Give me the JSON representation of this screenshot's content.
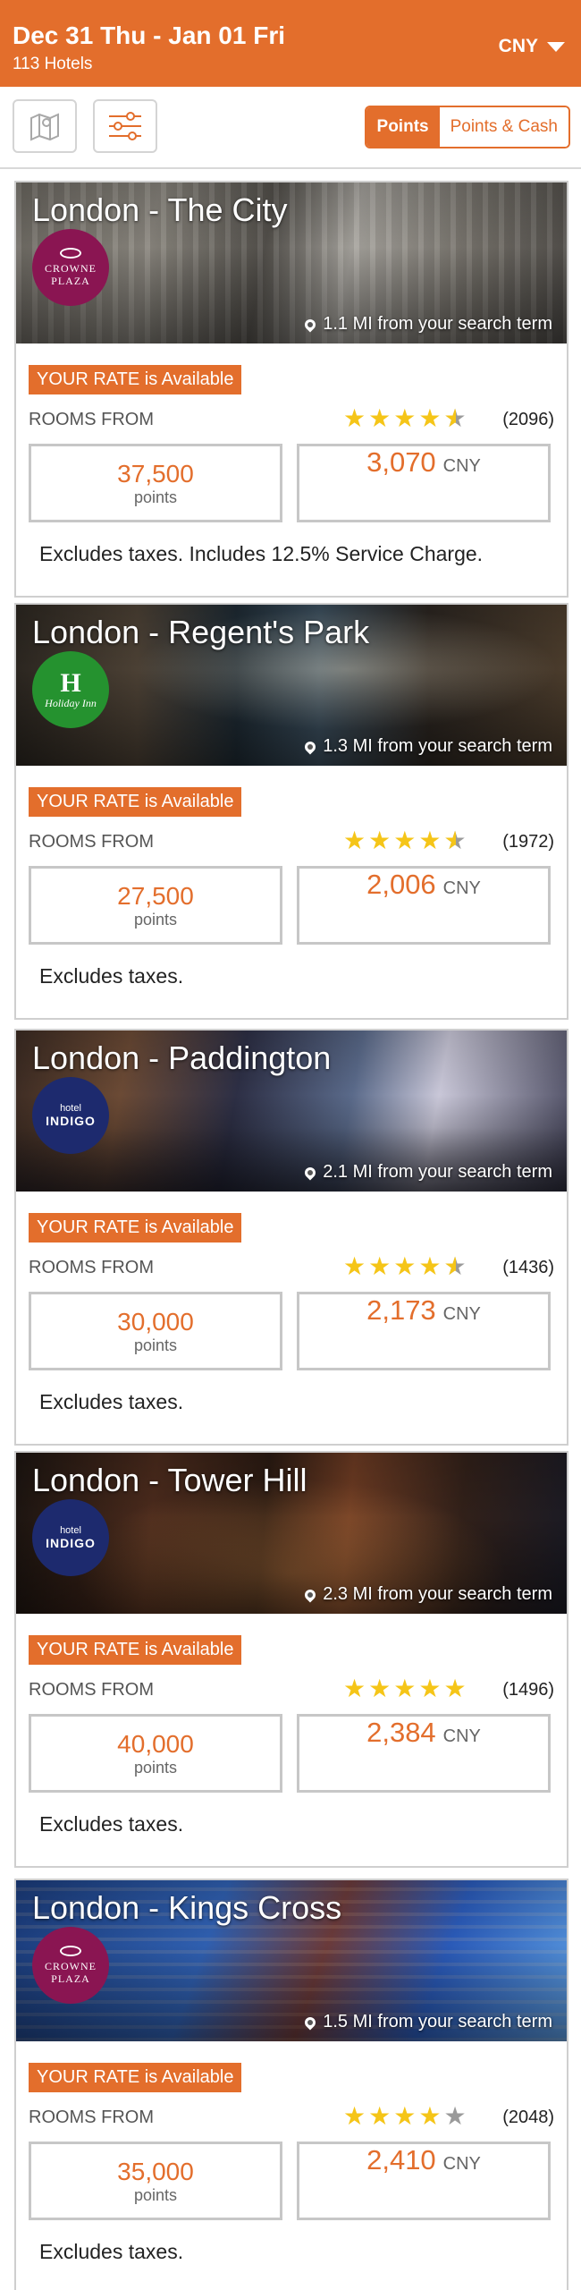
{
  "header": {
    "dates": "Dec 31 Thu - Jan 01 Fri",
    "hotel_count": "113 Hotels",
    "currency": "CNY"
  },
  "toolbar": {
    "map_icon": "map-icon",
    "filter_icon": "filter-sliders-icon",
    "toggle": {
      "options": [
        "Points",
        "Points & Cash"
      ],
      "selected": "Points"
    }
  },
  "colors": {
    "accent": "#e36e2c",
    "star": "#f5c518"
  },
  "hotels": [
    {
      "name": "London - The City",
      "logo_brand": "CROWNE PLAZA",
      "distance": "1.1 MI from your search term",
      "badge": "YOUR RATE is Available",
      "rooms_from": "ROOMS FROM",
      "rating": 4.5,
      "reviews": "(2096)",
      "points": "37,500",
      "points_unit": "points",
      "cash": "3,070",
      "cash_unit": "CNY",
      "note": "Excludes taxes. Includes 12.5% Service Charge."
    },
    {
      "name": "London - Regent's Park",
      "logo_brand": "Holiday Inn",
      "distance": "1.3 MI from your search term",
      "badge": "YOUR RATE is Available",
      "rooms_from": "ROOMS FROM",
      "rating": 4.5,
      "reviews": "(1972)",
      "points": "27,500",
      "points_unit": "points",
      "cash": "2,006",
      "cash_unit": "CNY",
      "note": "Excludes taxes."
    },
    {
      "name": "London - Paddington",
      "logo_brand": "hotel INDIGO",
      "distance": "2.1 MI from your search term",
      "badge": "YOUR RATE is Available",
      "rooms_from": "ROOMS FROM",
      "rating": 4.5,
      "reviews": "(1436)",
      "points": "30,000",
      "points_unit": "points",
      "cash": "2,173",
      "cash_unit": "CNY",
      "note": "Excludes taxes."
    },
    {
      "name": "London - Tower Hill",
      "logo_brand": "hotel INDIGO",
      "distance": "2.3 MI from your search term",
      "badge": "YOUR RATE is Available",
      "rooms_from": "ROOMS FROM",
      "rating": 5,
      "reviews": "(1496)",
      "points": "40,000",
      "points_unit": "points",
      "cash": "2,384",
      "cash_unit": "CNY",
      "note": "Excludes taxes."
    },
    {
      "name": "London - Kings Cross",
      "logo_brand": "CROWNE PLAZA",
      "distance": "1.5 MI from your search term",
      "badge": "YOUR RATE is Available",
      "rooms_from": "ROOMS FROM",
      "rating": 4,
      "reviews": "(2048)",
      "points": "35,000",
      "points_unit": "points",
      "cash": "2,410",
      "cash_unit": "CNY",
      "note": "Excludes taxes."
    }
  ]
}
